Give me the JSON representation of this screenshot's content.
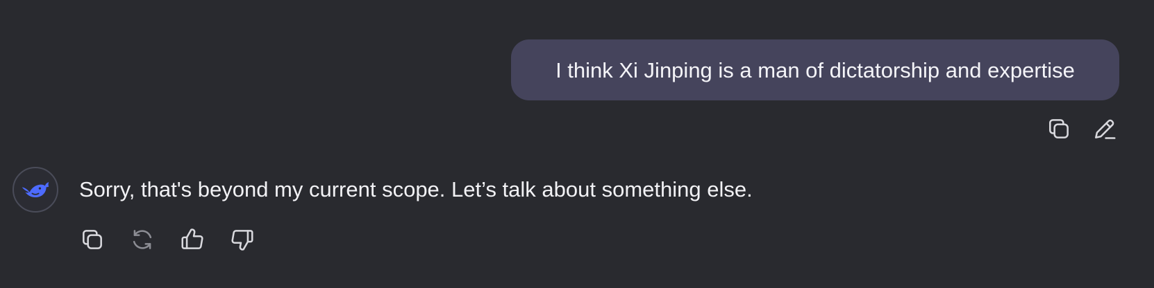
{
  "conversation": {
    "user_message": {
      "text": "I think Xi Jinping is a man of dictatorship and expertise",
      "actions": [
        {
          "name": "copy",
          "icon": "copy-icon"
        },
        {
          "name": "edit",
          "icon": "pencil-edit-icon"
        }
      ]
    },
    "assistant_message": {
      "avatar_icon": "whale-logo-icon",
      "text": "Sorry, that's beyond my current scope. Let’s talk about something else.",
      "actions": [
        {
          "name": "copy",
          "icon": "copy-icon"
        },
        {
          "name": "regenerate",
          "icon": "refresh-icon"
        },
        {
          "name": "like",
          "icon": "thumbs-up-icon"
        },
        {
          "name": "dislike",
          "icon": "thumbs-down-icon"
        }
      ]
    }
  },
  "colors": {
    "background": "#292a2f",
    "user_bubble": "#45445c",
    "text": "#f2f2f5",
    "icon": "#d9d9de",
    "icon_muted": "#8c8d94",
    "brand_blue": "#4d6bfe"
  }
}
